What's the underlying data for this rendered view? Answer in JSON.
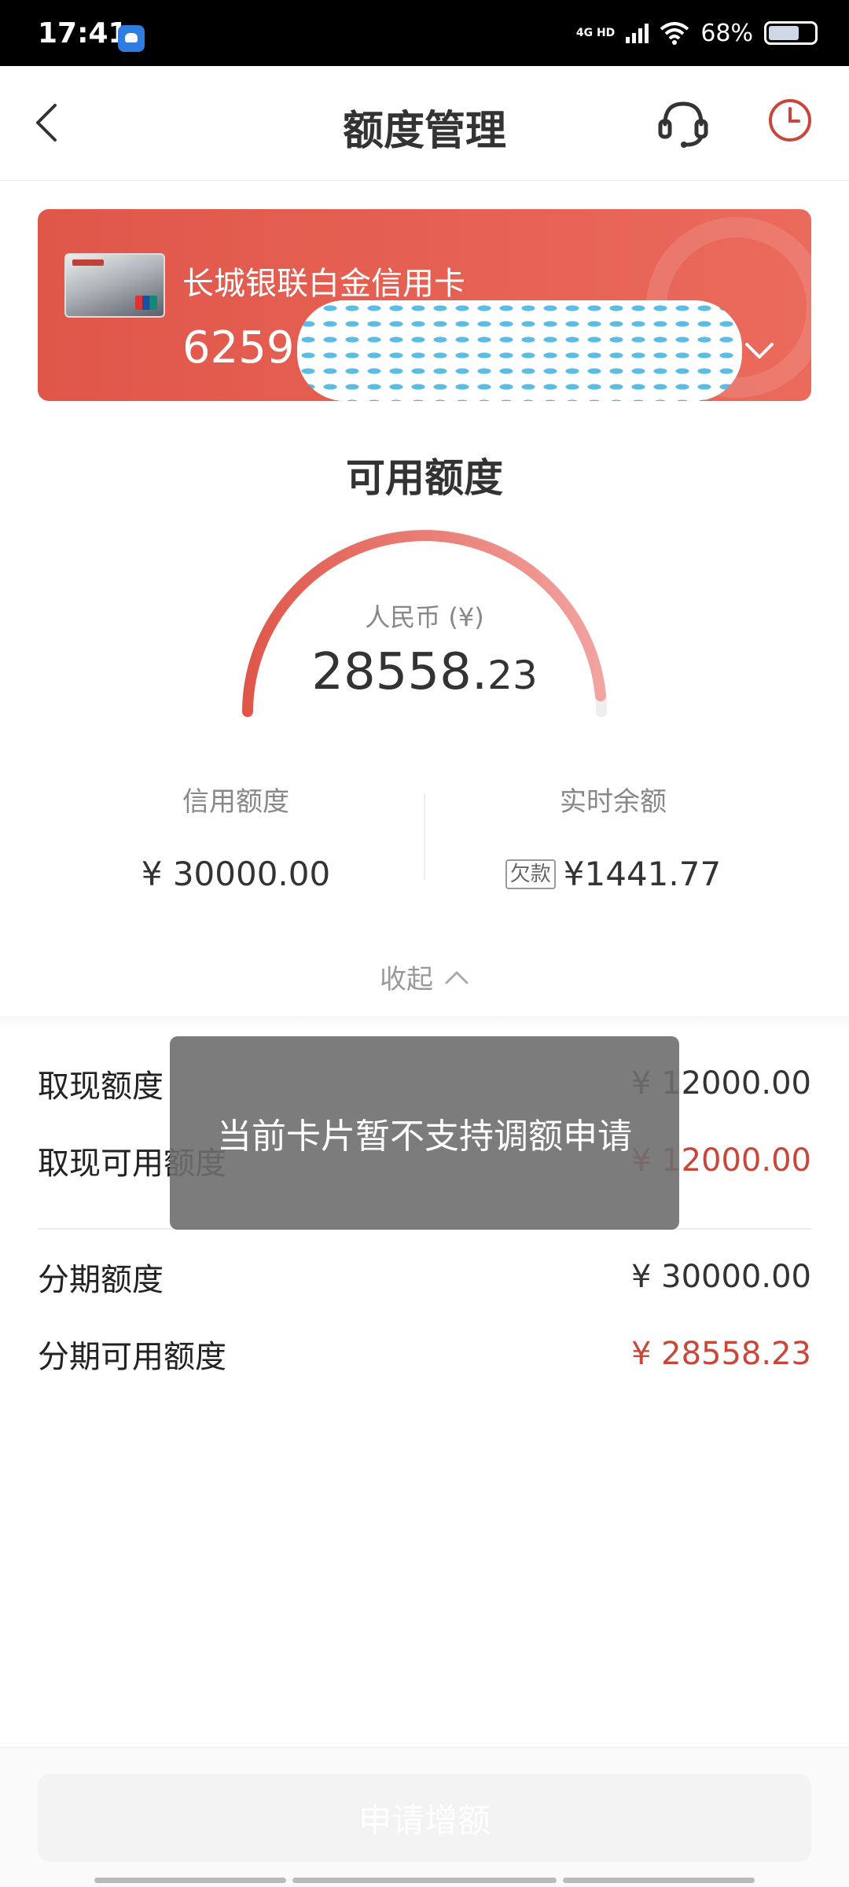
{
  "status_bar": {
    "time": "17:41",
    "network": "4G HD",
    "battery": "68%",
    "icons": [
      "app-notification-icon",
      "signal-icon",
      "wifi-icon",
      "battery-icon"
    ]
  },
  "header": {
    "title": "额度管理",
    "icons": [
      "back-arrow-icon",
      "customer-service-headset-icon",
      "history-clock-icon"
    ]
  },
  "card": {
    "name": "长城银联白金信用卡",
    "number_prefix": "6259"
  },
  "available": {
    "title": "可用额度",
    "currency_label": "人民币 (¥)",
    "amount_int": "28558.",
    "amount_dec": "23"
  },
  "stats": {
    "credit_limit_label": "信用额度",
    "credit_limit_value": "¥ 30000.00",
    "balance_label": "实时余额",
    "balance_badge": "欠款",
    "balance_value": "¥1441.77"
  },
  "collapse_label": "收起",
  "details": [
    {
      "label": "取现额度",
      "value": "¥ 12000.00"
    },
    {
      "label": "取现可用额度",
      "value": "¥ 12000.00"
    },
    {
      "label": "分期额度",
      "value": "¥ 30000.00"
    },
    {
      "label": "分期可用额度",
      "value": "¥ 28558.23"
    }
  ],
  "toast": "当前卡片暂不支持调额申请",
  "apply_button": "申请增额",
  "colors": {
    "accent_red": "#e0574a",
    "value_red": "#c9463b"
  }
}
